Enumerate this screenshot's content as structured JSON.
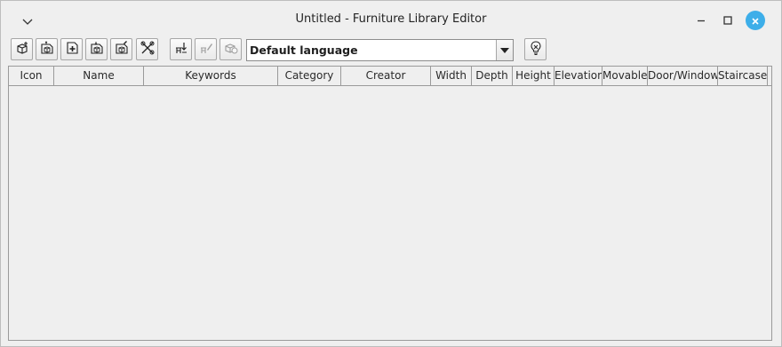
{
  "window": {
    "title": "Untitled - Furniture Library Editor"
  },
  "toolbar": {
    "language_select": {
      "value": "Default language"
    }
  },
  "table": {
    "columns": [
      "Icon",
      "Name",
      "Keywords",
      "Category",
      "Creator",
      "Width",
      "Depth",
      "Height",
      "Elevation",
      "Movable",
      "Door/Window",
      "Staircase"
    ],
    "rows": []
  }
}
